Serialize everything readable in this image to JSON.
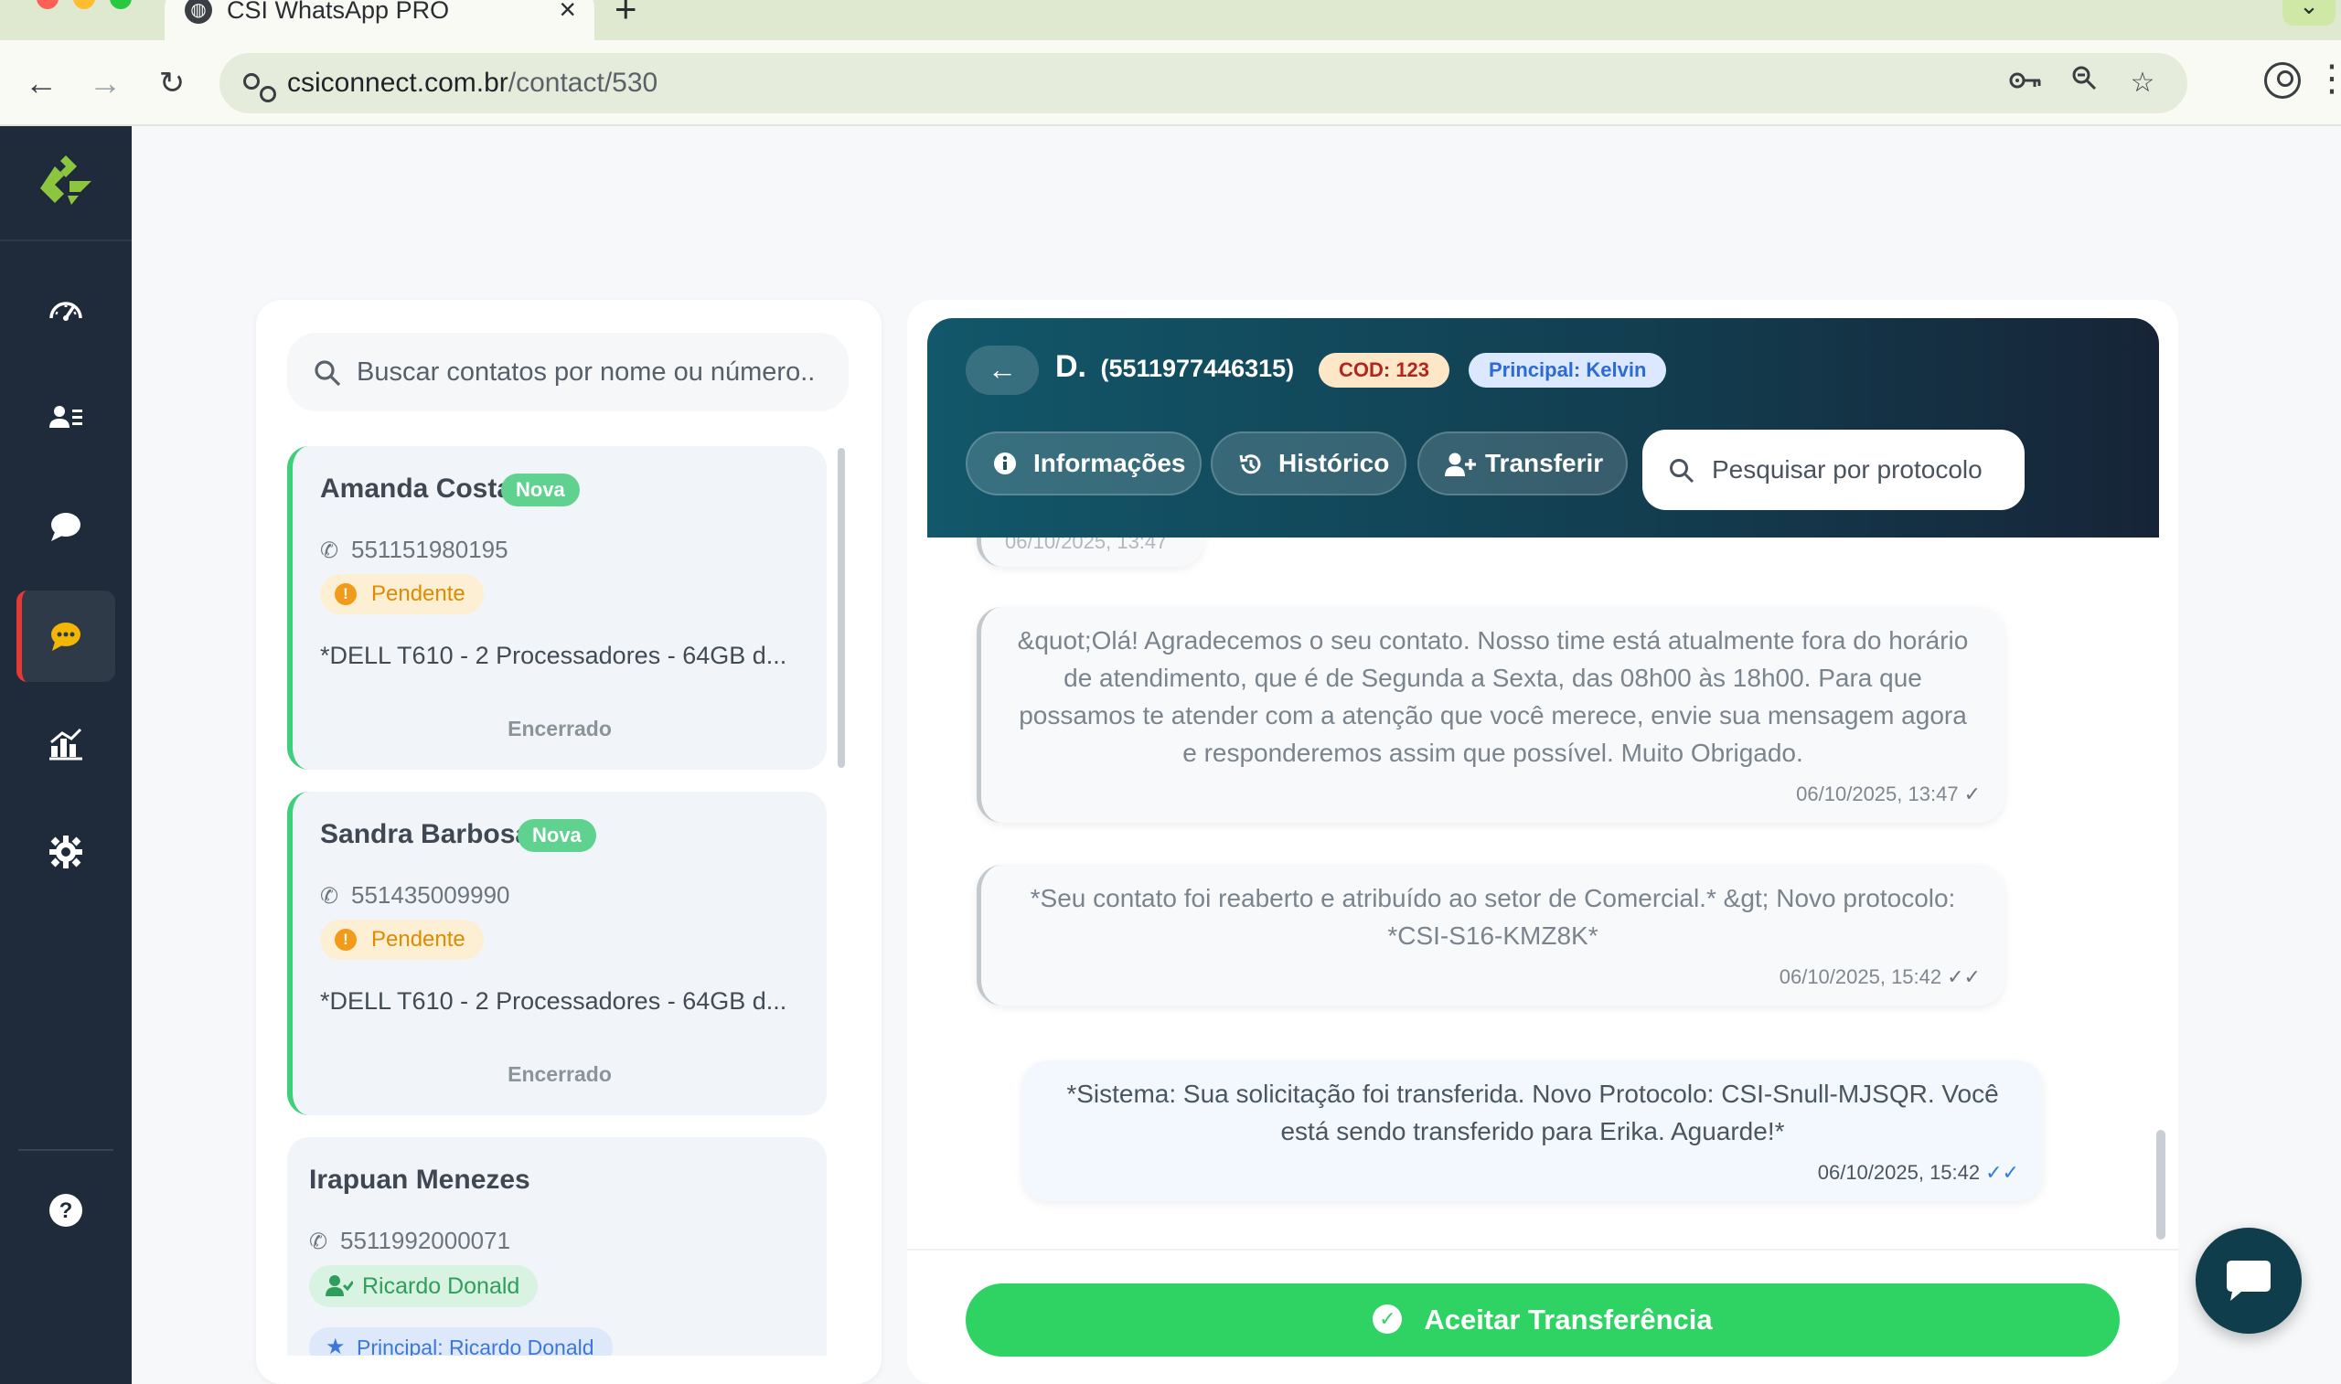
{
  "browser": {
    "tab_title": "CSI WhatsApp PRO",
    "url_domain": "csiconnect.com.br",
    "url_path": "/contact/530"
  },
  "contacts": {
    "search_placeholder": "Buscar contatos por nome ou número..",
    "items": [
      {
        "name": "Amanda Costa",
        "badge": "Nova",
        "phone": "551151980195",
        "status": "Pendente",
        "preview": "*DELL T610 - 2 Processadores - 64GB d...",
        "footer": "Encerrado"
      },
      {
        "name": "Sandra Barbosa",
        "badge": "Nova",
        "phone": "551435009990",
        "status": "Pendente",
        "preview": "*DELL T610 - 2 Processadores - 64GB d...",
        "footer": "Encerrado"
      },
      {
        "name": "Irapuan Menezes",
        "phone": "5511992000071",
        "agent": "Ricardo Donald",
        "principal": "Principal: Ricardo Donald"
      }
    ]
  },
  "chat": {
    "contact_name": "D.",
    "contact_phone": "(5511977446315)",
    "cod": "COD: 123",
    "principal": "Principal: Kelvin",
    "buttons": {
      "info": "Informações",
      "history": "Histórico",
      "transfer": "Transferir"
    },
    "protocol_search_placeholder": "Pesquisar por protocolo",
    "partial_time": "06/10/2025, 13:47",
    "messages": [
      {
        "text": "&quot;Olá! Agradecemos o seu contato. Nosso time está atualmente fora do horário de atendimento, que é de Segunda a Sexta, das 08h00 às 18h00. Para que possamos te atender com a atenção que você merece, envie sua mensagem agora e responderemos assim que possível. Muito Obrigado.",
        "time": "06/10/2025, 13:47",
        "tick": "✓"
      },
      {
        "text": "*Seu contato foi reaberto e atribuído ao setor de Comercial.* &gt; Novo protocolo: *CSI-S16-KMZ8K*",
        "time": "06/10/2025, 15:42",
        "tick": "✓✓"
      },
      {
        "text": "*Sistema: Sua solicitação foi transferida. Novo Protocolo: CSI-Snull-MJSQR. Você está sendo transferido para Erika. Aguarde!*",
        "time": "06/10/2025, 15:42",
        "tick": "✓✓"
      }
    ],
    "accept_label": "Aceitar Transferência"
  },
  "colors": {
    "sidebar_bg": "#1f2a3a",
    "header_gradient_start": "#12576a",
    "header_gradient_end": "#172437",
    "accept_green": "#2fd364",
    "accent_red": "#e53935",
    "logo_green": "#8cc63f"
  },
  "icons": {
    "sidebar": [
      "dashboard-icon",
      "contacts-icon",
      "chat-bubble-icon",
      "active-chat-icon",
      "reports-icon",
      "settings-icon",
      "help-icon"
    ],
    "fab": "chat-fab-icon"
  }
}
